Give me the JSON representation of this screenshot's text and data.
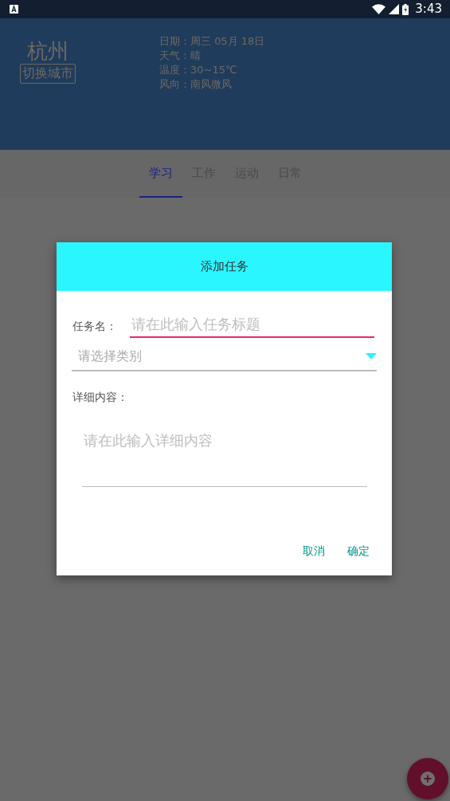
{
  "status_bar": {
    "time": "3:43"
  },
  "header": {
    "city": "杭州",
    "switch_button": "切换城市",
    "weather": [
      "日期：周三 05月 18日",
      "天气：晴",
      "温度：30~15℃",
      "风向：南风微风"
    ]
  },
  "tabs": [
    {
      "label": "学习",
      "selected": true
    },
    {
      "label": "工作",
      "selected": false
    },
    {
      "label": "运动",
      "selected": false
    },
    {
      "label": "日常",
      "selected": false
    }
  ],
  "dialog": {
    "title": "添加任务",
    "name_label": "任务名：",
    "name_placeholder": "请在此输入任务标题",
    "category_placeholder": "请选择类别",
    "detail_label": "详细内容：",
    "detail_placeholder": "请在此输入详细内容",
    "buttons": [
      "取消",
      "确定"
    ]
  },
  "fab": {
    "kind": "add"
  }
}
